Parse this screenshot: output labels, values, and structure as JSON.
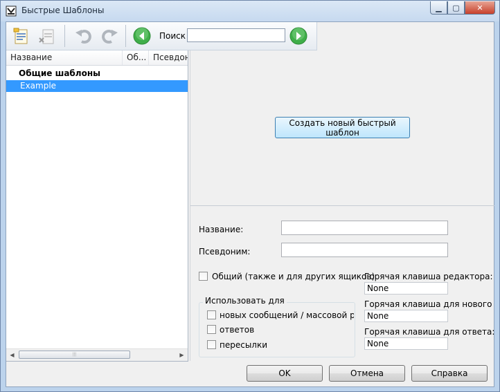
{
  "window": {
    "title": "Быстрые Шаблоны"
  },
  "toolbar": {
    "icons": [
      "new-template-icon",
      "delete-template-icon",
      "undo-icon",
      "redo-icon",
      "back-arrow-icon",
      "forward-arrow-icon"
    ],
    "search_label": "Поиск",
    "search_value": ""
  },
  "list": {
    "columns": [
      "Название",
      "Об...",
      "Псевдон"
    ],
    "rows": [
      {
        "label": "Общие шаблоны",
        "type": "group"
      },
      {
        "label": "Example",
        "type": "item",
        "selected": true
      }
    ]
  },
  "panel": {
    "create_button": "Создать новый быстрый шаблон",
    "name_label": "Название:",
    "alias_label": "Псевдоним:",
    "name_value": "",
    "alias_value": "",
    "shared_checkbox": "Общий (также и для других ящиков)",
    "use_for_group": "Использовать для",
    "use_for": [
      "новых сообщений / массовой расс",
      "ответов",
      "пересылки"
    ],
    "hotkeys": [
      {
        "label": "Горячая клавиша редактора:",
        "value": "None"
      },
      {
        "label": "Горячая клавиша для нового сообщ",
        "value": "None"
      },
      {
        "label": "Горячая клавиша для ответа:",
        "value": "None"
      }
    ]
  },
  "buttons": {
    "ok": "OK",
    "cancel": "Отмена",
    "help": "Справка"
  },
  "colors": {
    "selection": "#3399ff",
    "accent_green": "#3fae49"
  }
}
